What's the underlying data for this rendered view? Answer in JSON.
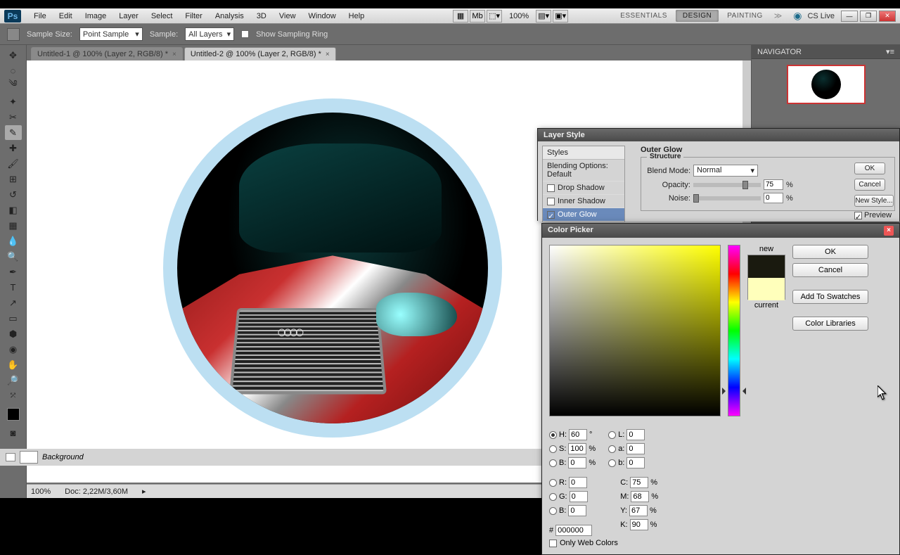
{
  "menubar": {
    "items": [
      "File",
      "Edit",
      "Image",
      "Layer",
      "Select",
      "Filter",
      "Analysis",
      "3D",
      "View",
      "Window",
      "Help"
    ],
    "zoom": "100%",
    "workspaces": [
      "ESSENTIALS",
      "DESIGN",
      "PAINTING"
    ],
    "cslive": "CS Live"
  },
  "optbar": {
    "sample_size_label": "Sample Size:",
    "sample_size": "Point Sample",
    "sample_label": "Sample:",
    "sample": "All Layers",
    "show_ring": "Show Sampling Ring"
  },
  "tabs": [
    {
      "label": "Untitled-1 @ 100% (Layer 2, RGB/8) *"
    },
    {
      "label": "Untitled-2 @ 100% (Layer 2, RGB/8) *"
    }
  ],
  "status": {
    "zoom": "100%",
    "doc": "Doc: 2,22M/3,60M"
  },
  "navigator": {
    "title": "NAVIGATOR"
  },
  "layer_style": {
    "title": "Layer Style",
    "styles_hdr": "Styles",
    "blending": "Blending Options: Default",
    "effects": {
      "drop_shadow": "Drop Shadow",
      "inner_shadow": "Inner Shadow",
      "outer_glow": "Outer Glow"
    },
    "section": "Outer Glow",
    "structure": "Structure",
    "blend_mode_label": "Blend Mode:",
    "blend_mode": "Normal",
    "opacity_label": "Opacity:",
    "opacity": "75",
    "noise_label": "Noise:",
    "noise": "0",
    "pct": "%",
    "ok": "OK",
    "cancel": "Cancel",
    "new_style": "New Style...",
    "preview": "Preview"
  },
  "color_picker": {
    "title": "Color Picker",
    "new": "new",
    "current": "current",
    "ok": "OK",
    "cancel": "Cancel",
    "add": "Add To Swatches",
    "libs": "Color Libraries",
    "only_web": "Only Web Colors",
    "H": "60",
    "S": "100",
    "B": "0",
    "L": "0",
    "a": "0",
    "b": "0",
    "R": "0",
    "G": "0",
    "Bl": "0",
    "C": "75",
    "M": "68",
    "Y": "67",
    "K": "90",
    "hex": "000000",
    "deg": "°",
    "pct": "%",
    "hash": "#",
    "lbl": {
      "H": "H:",
      "S": "S:",
      "B": "B:",
      "L": "L:",
      "a": "a:",
      "b": "b:",
      "R": "R:",
      "G": "G:",
      "Bl": "B:",
      "C": "C:",
      "M": "M:",
      "Y": "Y:",
      "K": "K:"
    }
  },
  "bg_layer": "Background"
}
